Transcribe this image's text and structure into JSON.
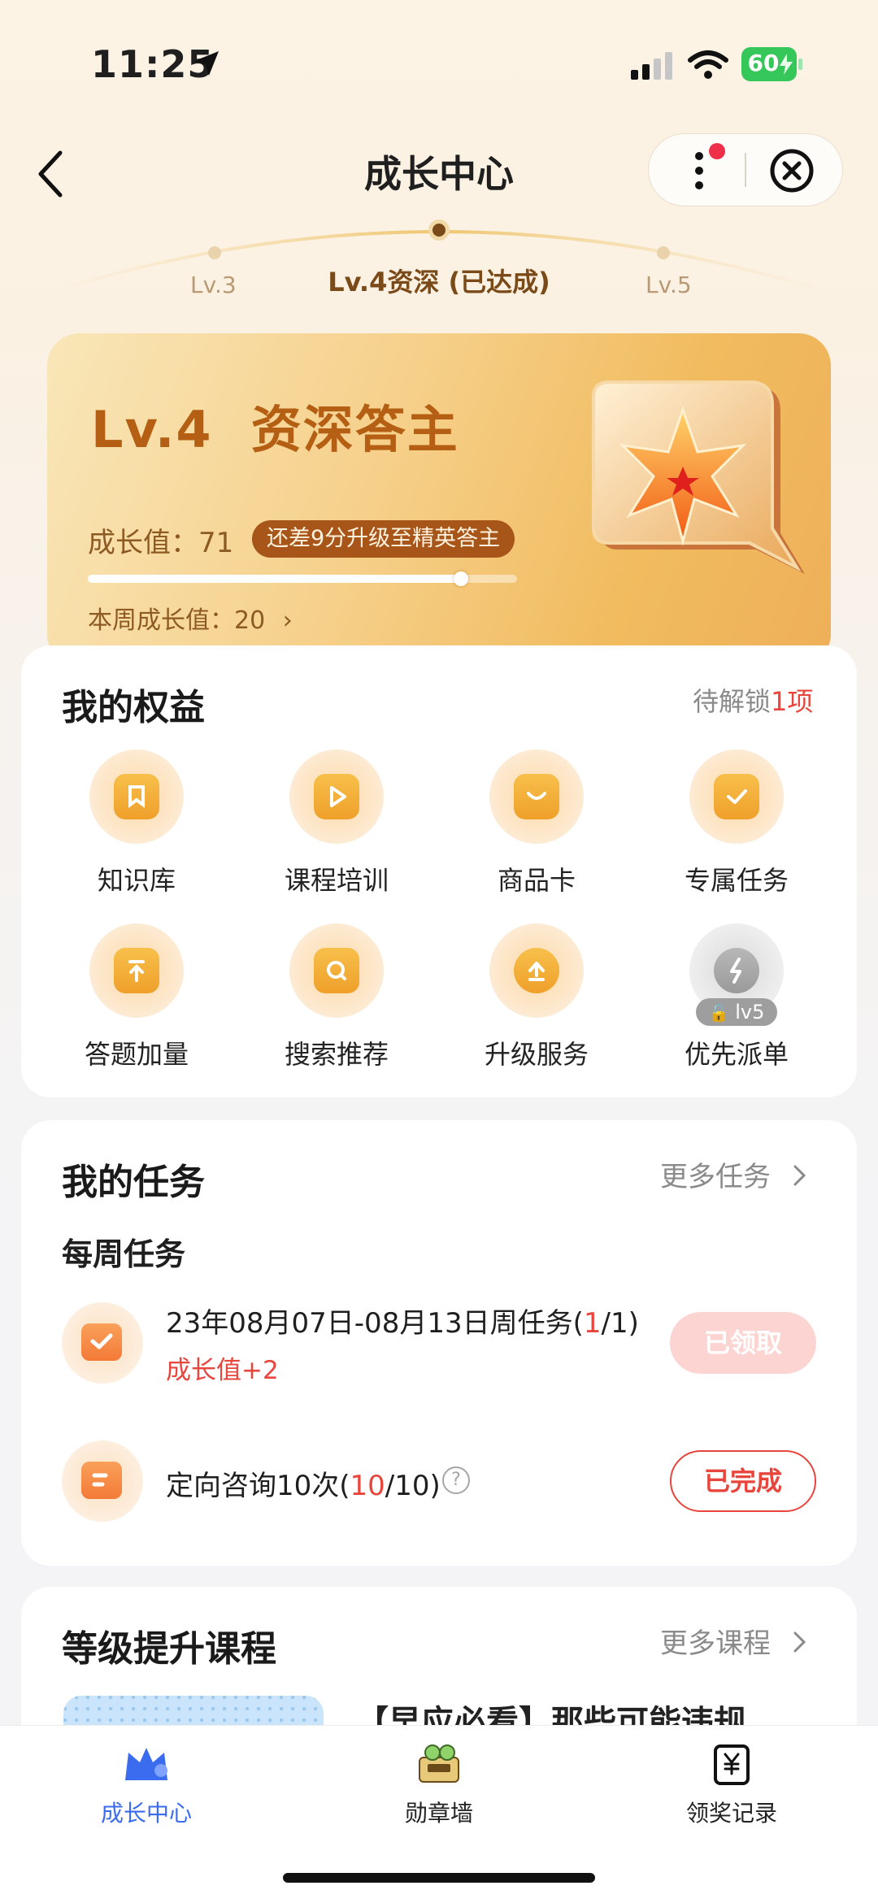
{
  "status_bar": {
    "time": "11:25",
    "battery": "60"
  },
  "nav": {
    "title": "成长中心"
  },
  "level_track": {
    "prev": "Lv.3",
    "current": "Lv.4资深 (已达成)",
    "next": "Lv.5"
  },
  "level_card": {
    "title": "Lv.4  资深答主",
    "growth_label": "成长值：71",
    "gap_badge": "还差9分升级至精英答主",
    "progress": 0.87,
    "weekly": "本周成长值：20",
    "weekly_arrow": "›"
  },
  "benefits": {
    "title": "我的权益",
    "pending_prefix": "待解锁",
    "pending_count": "1项",
    "items": [
      {
        "label": "知识库",
        "icon": "knowledge-icon"
      },
      {
        "label": "课程培训",
        "icon": "course-play-icon"
      },
      {
        "label": "商品卡",
        "icon": "shopping-bag-icon"
      },
      {
        "label": "专属任务",
        "icon": "task-check-icon"
      },
      {
        "label": "答题加量",
        "icon": "upload-arrow-icon"
      },
      {
        "label": "搜索推荐",
        "icon": "search-icon"
      },
      {
        "label": "升级服务",
        "icon": "upgrade-icon"
      },
      {
        "label": "优先派单",
        "icon": "lightning-icon",
        "locked": true,
        "lock_label": "lv5"
      }
    ]
  },
  "tasks": {
    "title": "我的任务",
    "more": "更多任务",
    "section": "每周任务",
    "items": [
      {
        "name_pre": "23年08月07日-08月13日周任务(",
        "done": "1",
        "name_post": "/1)",
        "reward": "成长值+2",
        "button": "已领取"
      },
      {
        "name_pre": "定向咨询10次(",
        "done": "10",
        "name_post": "/10)",
        "button": "已完成"
      }
    ]
  },
  "courses": {
    "title": "等级提升课程",
    "more": "更多课程",
    "first_title": "【早应必看】那些可能违规"
  },
  "tabbar": {
    "items": [
      {
        "label": "成长中心",
        "active": true
      },
      {
        "label": "勋章墙",
        "active": false
      },
      {
        "label": "领奖记录",
        "active": false
      }
    ]
  },
  "colors": {
    "accent_red": "#e8453c",
    "tab_active": "#3b6cf0",
    "gold": "#b45f13"
  }
}
